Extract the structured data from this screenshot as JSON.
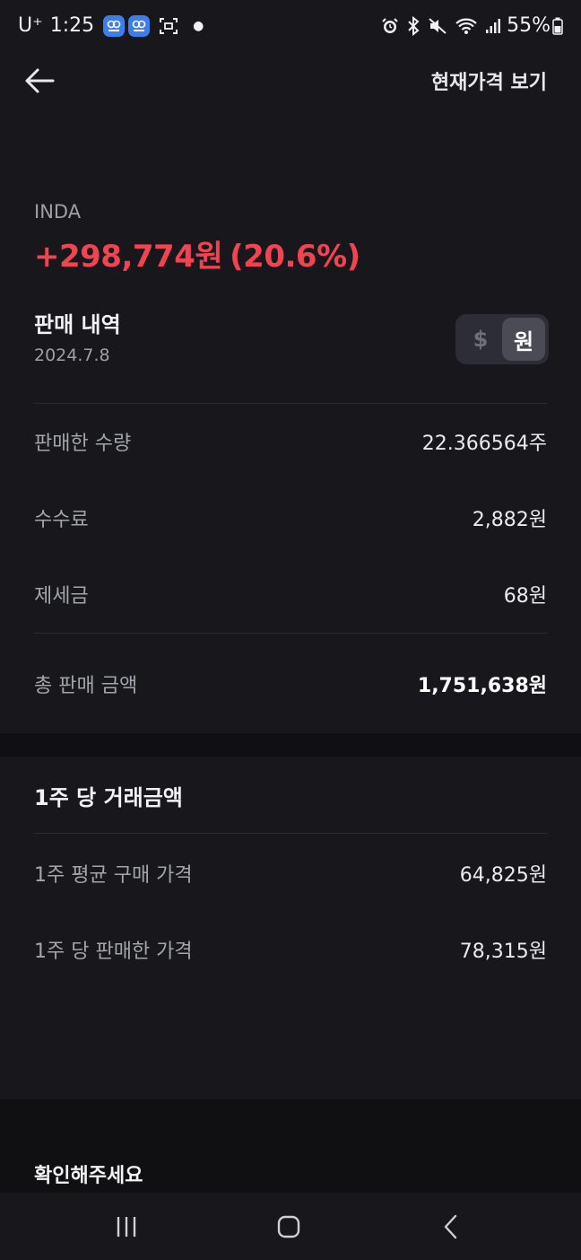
{
  "status_bar": {
    "carrier": "U⁺",
    "time": "1:25",
    "battery": "55%",
    "icons": [
      "app-badge-icon",
      "app-badge-icon",
      "screen-capture-icon",
      "alarm-icon",
      "bluetooth-icon",
      "mute-icon",
      "wifi-icon",
      "signal-icon",
      "battery-icon"
    ]
  },
  "header": {
    "current_price_label": "현재가격 보기"
  },
  "summary": {
    "ticker": "INDA",
    "profit_amount": "+298,774원",
    "profit_percent": "(20.6%)",
    "profit_color": "#f04452",
    "section_title": "판매 내역",
    "sale_date": "2024.7.8",
    "currency_toggle": {
      "options": [
        "$",
        "원"
      ],
      "selected": "원"
    },
    "rows": [
      {
        "label": "판매한 수량",
        "value": "22.366564주"
      },
      {
        "label": "수수료",
        "value": "2,882원"
      },
      {
        "label": "제세금",
        "value": "68원"
      }
    ],
    "total": {
      "label": "총 판매 금액",
      "value": "1,751,638원"
    }
  },
  "per_share": {
    "title": "1주 당 거래금액",
    "rows": [
      {
        "label": "1주 평균 구매 가격",
        "value": "64,825원"
      },
      {
        "label": "1주 당 판매한 가격",
        "value": "78,315원"
      }
    ]
  },
  "confirm": {
    "title": "확인해주세요"
  },
  "nav_bar": {
    "buttons": [
      "recent-apps-icon",
      "home-icon",
      "back-icon"
    ]
  }
}
